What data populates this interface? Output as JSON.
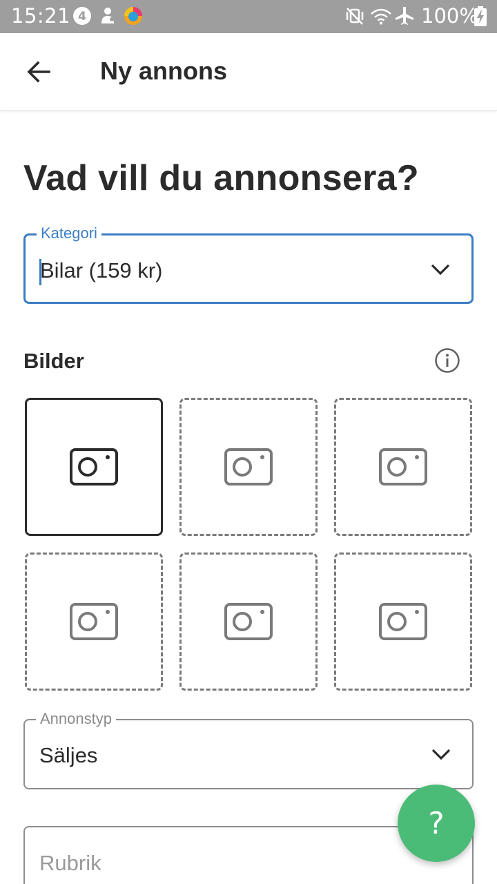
{
  "status_bar": {
    "time": "15:21",
    "battery": "100%",
    "icons": [
      "four-badge-icon",
      "person-notification-icon",
      "browser-app-icon",
      "vibrate-mute-icon",
      "wifi-icon",
      "airplane-mode-icon",
      "battery-charging-icon"
    ]
  },
  "app_bar": {
    "title": "Ny annons",
    "back_icon": "arrow-left-icon"
  },
  "form": {
    "heading": "Vad vill du annonsera?",
    "category": {
      "label": "Kategori",
      "value": "Bilar (159 kr)",
      "icon": "chevron-down-icon"
    },
    "images": {
      "title": "Bilder",
      "info_icon": "info-icon",
      "slot_icon": "camera-icon",
      "slot_count": 6
    },
    "ad_type": {
      "label": "Annonstyp",
      "value": "Säljes",
      "icon": "chevron-down-icon"
    },
    "headline": {
      "placeholder": "Rubrik"
    }
  },
  "help_button": {
    "label": "?"
  },
  "colors": {
    "status_bar": "#9e9e9e",
    "focus_accent": "#3b7dc4",
    "fab": "#4bbb78",
    "text": "#2b2b2b"
  }
}
